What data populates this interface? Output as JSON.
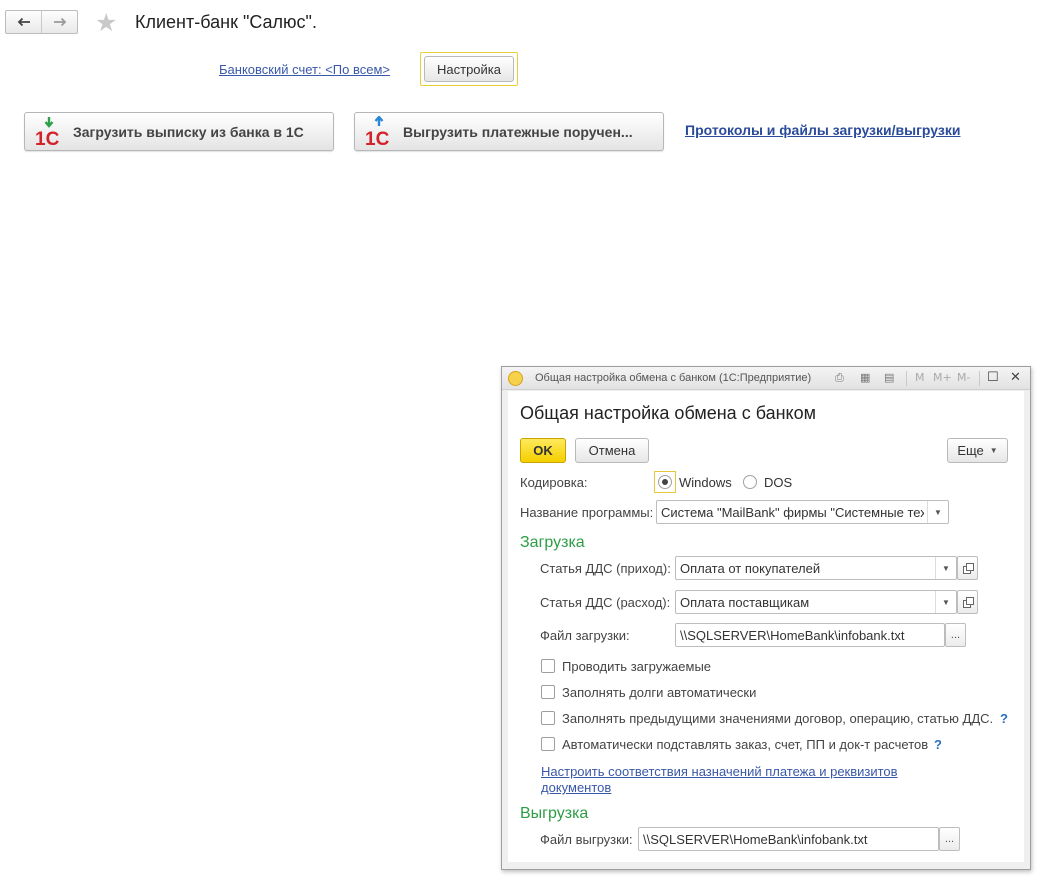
{
  "page": {
    "title": "Клиент-банк \"Салюс\".",
    "account_link": "Банковский счет: <По всем>",
    "settings_label": "Настройка",
    "load_label": "Загрузить выписку из банка в 1С",
    "unload_label": "Выгрузить платежные поручен...",
    "protocols_link": "Протоколы и файлы загрузки/выгрузки"
  },
  "dialog": {
    "window_title": "Общая настройка обмена с банком  (1С:Предприятие)",
    "toolbar_m": "M",
    "toolbar_mplus": "M+",
    "toolbar_mminus": "M-",
    "heading": "Общая настройка обмена с банком",
    "ok_label": "OK",
    "cancel_label": "Отмена",
    "more_label": "Еще",
    "encoding_label": "Кодировка:",
    "encoding_options": [
      "Windows",
      "DOS"
    ],
    "encoding_selected": "Windows",
    "program_label": "Название программы:",
    "program_value": "Система \"MailBank\" фирмы \"Системные тех",
    "load_section": "Загрузка",
    "dds_income_label": "Статья ДДС (приход):",
    "dds_income_value": "Оплата от покупателей",
    "dds_expense_label": "Статья ДДС (расход):",
    "dds_expense_value": "Оплата поставщикам",
    "load_file_label": "Файл загрузки:",
    "load_file_value": "\\\\SQLSERVER\\HomeBank\\infobank.txt",
    "ellipsis": "...",
    "checkboxes": [
      {
        "label": "Проводить загружаемые",
        "checked": false
      },
      {
        "label": "Заполнять долги автоматически",
        "checked": false
      },
      {
        "label": "Заполнять предыдущими значениями договор, операцию, статью ДДС.",
        "checked": false
      },
      {
        "label": "Автоматически подставлять заказ, счет, ПП и док-т расчетов",
        "checked": false
      }
    ],
    "help_mark": "?",
    "mapping_link": "Настроить соответствия назначений платежа и реквизитов документов",
    "unload_section": "Выгрузка",
    "unload_file_label": "Файл выгрузки:",
    "unload_file_value": "\\\\SQLSERVER\\HomeBank\\infobank.txt"
  },
  "colors": {
    "accent_yellow": "#f4cf00",
    "section_green": "#2e9e45",
    "link_blue": "#3a58a8"
  }
}
